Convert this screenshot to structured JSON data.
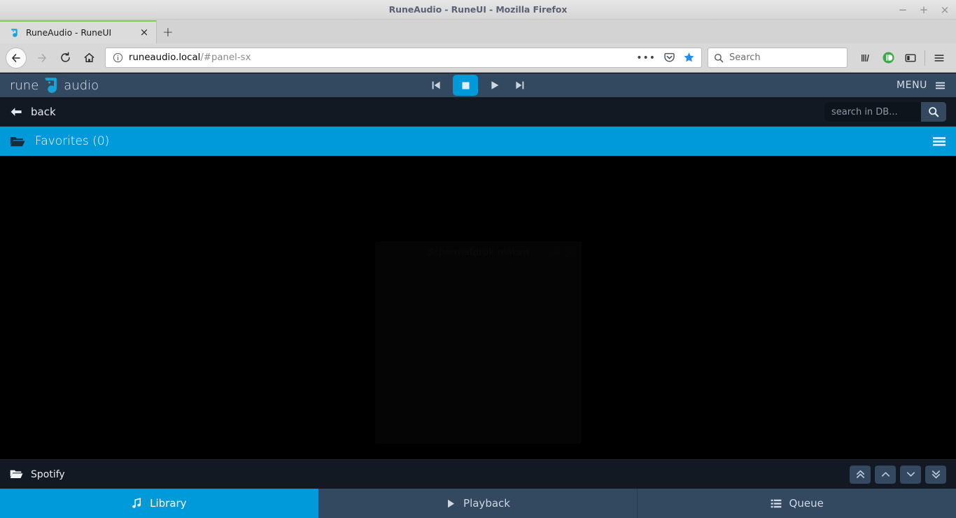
{
  "window": {
    "title": "RuneAudio - RuneUI - Mozilla Firefox",
    "minimize_label": "−",
    "maximize_label": "+",
    "close_label": "×"
  },
  "browser": {
    "tab": {
      "title": "RuneAudio - RuneUI",
      "close_label": "×",
      "favicon_name": "runeaudio-favicon"
    },
    "new_tab_label": "+",
    "nav": {
      "back_icon": "arrow-left-icon",
      "forward_icon": "arrow-right-icon",
      "reload_icon": "reload-icon",
      "home_icon": "home-icon"
    },
    "url": {
      "host": "runeaudio.local",
      "path": "/#panel-sx",
      "info_icon": "page-info-icon",
      "overflow_label": "•••",
      "pocket_icon": "pocket-icon",
      "bookmark_icon": "star-icon"
    },
    "search": {
      "placeholder": "Search",
      "icon": "search-icon"
    },
    "toolbar_icons": [
      {
        "name": "library-icon"
      },
      {
        "name": "pushbullet-addon-icon"
      },
      {
        "name": "sidebar-toggle-icon"
      },
      {
        "name": "hamburger-menu-icon"
      }
    ]
  },
  "app": {
    "logo": {
      "word_left": "rune",
      "word_right": "audio"
    },
    "transport": {
      "previous_label": "previous-track",
      "stop_label": "stop",
      "play_label": "play",
      "next_label": "next-track",
      "active": "stop"
    },
    "menu": {
      "label": "MENU",
      "icon": "hamburger-menu-icon"
    },
    "subbar": {
      "back_label": "back",
      "back_icon": "arrow-left-icon",
      "db_search": {
        "value": "",
        "placeholder": "search in DB...",
        "button_icon": "search-icon"
      }
    },
    "favorites": {
      "label": "Favorites (0)",
      "folder_icon": "folder-open-icon",
      "menu_icon": "list-menu-icon"
    },
    "content": {
      "ghost_dialog_title": "Schermafdruk maken",
      "ghost_minimize_label": "−",
      "ghost_close_label": "×"
    },
    "status": {
      "label": "Spotify",
      "folder_icon": "folder-open-icon",
      "scroll_buttons": [
        {
          "name": "scroll-top-button",
          "icon": "double-chevron-up-icon"
        },
        {
          "name": "scroll-up-button",
          "icon": "chevron-up-icon"
        },
        {
          "name": "scroll-down-button",
          "icon": "chevron-down-icon"
        },
        {
          "name": "scroll-bottom-button",
          "icon": "double-chevron-down-icon"
        }
      ]
    },
    "tabs": [
      {
        "label": "Library",
        "icon": "music-note-icon",
        "active": true
      },
      {
        "label": "Playback",
        "icon": "play-icon",
        "active": false
      },
      {
        "label": "Queue",
        "icon": "list-icon",
        "active": false
      }
    ],
    "colors": {
      "accent_blue": "#009ada",
      "header_navy": "#33495f",
      "dark_navy": "#121922",
      "content_black": "#000000"
    }
  }
}
